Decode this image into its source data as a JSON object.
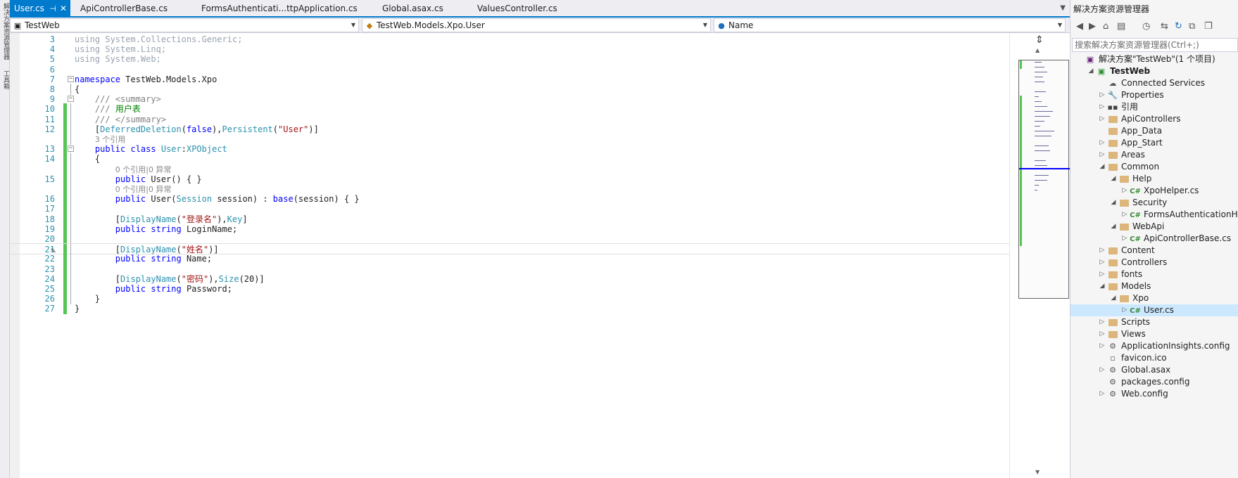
{
  "left_strip": {
    "tabs": [
      "解决方案资源管理器",
      "工具箱"
    ]
  },
  "tabs": [
    {
      "label": "User.cs",
      "active": true,
      "pin": "⊣",
      "close": "✕"
    },
    {
      "label": "ApiControllerBase.cs"
    },
    {
      "label": "FormsAuthenticati...ttpApplication.cs"
    },
    {
      "label": "Global.asax.cs"
    },
    {
      "label": "ValuesController.cs"
    }
  ],
  "nav": {
    "project": "TestWeb",
    "type": "TestWeb.Models.Xpo.User",
    "member": "Name"
  },
  "code": {
    "lines": [
      {
        "n": "3",
        "html": "<span class='dim'>using System.Collections.Generic;</span>"
      },
      {
        "n": "4",
        "html": "<span class='dim'>using System.Linq;</span>"
      },
      {
        "n": "5",
        "html": "<span class='dim'>using System.Web;</span>"
      },
      {
        "n": "6",
        "html": ""
      },
      {
        "n": "7",
        "html": "<span class='kw'>namespace</span> TestWeb.Models.Xpo"
      },
      {
        "n": "8",
        "html": "{"
      },
      {
        "n": "9",
        "html": "    <span class='gr'>/// &lt;summary&gt;</span>"
      },
      {
        "n": "10",
        "html": "    <span class='gr'>///</span> <span class='cm'>用户表</span>"
      },
      {
        "n": "11",
        "html": "    <span class='gr'>/// &lt;/summary&gt;</span>"
      },
      {
        "n": "12",
        "html": "    [<span class='tp'>DeferredDeletion</span>(<span class='kw'>false</span>),<span class='tp'>Persistent</span>(<span class='st'>\"User\"</span>)]"
      },
      {
        "n": "",
        "html": "    <span class='lens'>3 个引用</span>"
      },
      {
        "n": "13",
        "html": "    <span class='kw'>public class</span> <span class='tp'>User</span>:<span class='tp'>XPObject</span>"
      },
      {
        "n": "14",
        "html": "    {"
      },
      {
        "n": "",
        "html": "        <span class='lens'>0 个引用|0 异常</span>"
      },
      {
        "n": "15",
        "html": "        <span class='kw'>public</span> User() { }"
      },
      {
        "n": "",
        "html": "        <span class='lens'>0 个引用|0 异常</span>"
      },
      {
        "n": "16",
        "html": "        <span class='kw'>public</span> User(<span class='tp'>Session</span> session) : <span class='kw'>base</span>(session) { }"
      },
      {
        "n": "17",
        "html": ""
      },
      {
        "n": "18",
        "html": "        [<span class='tp'>DisplayName</span>(<span class='st'>\"登录名\"</span>),<span class='tp'>Key</span>]"
      },
      {
        "n": "19",
        "html": "        <span class='kw'>public string</span> LoginName;"
      },
      {
        "n": "20",
        "html": ""
      },
      {
        "n": "21",
        "html": "        [<span class='tp'>DisplayName</span>(<span class='st'>\"姓名\"</span>)]"
      },
      {
        "n": "22",
        "html": "        <span class='kw'>public string</span> Name;"
      },
      {
        "n": "23",
        "html": ""
      },
      {
        "n": "24",
        "html": "        [<span class='tp'>DisplayName</span>(<span class='st'>\"密码\"</span>),<span class='tp'>Size</span>(20)]"
      },
      {
        "n": "25",
        "html": "        <span class='kw'>public string</span> Password;"
      },
      {
        "n": "26",
        "html": "    }"
      },
      {
        "n": "27",
        "html": "}"
      }
    ]
  },
  "solution_explorer": {
    "title": "解决方案资源管理器",
    "search_placeholder": "搜索解决方案资源管理器(Ctrl+;)",
    "tree": [
      {
        "label": "解决方案\"TestWeb\"(1 个项目)",
        "level": 0,
        "icon": "solution",
        "exp": ""
      },
      {
        "label": "TestWeb",
        "level": 1,
        "icon": "project",
        "exp": "open",
        "bold": true
      },
      {
        "label": "Connected Services",
        "level": 2,
        "icon": "cloud",
        "exp": ""
      },
      {
        "label": "Properties",
        "level": 2,
        "icon": "wrench",
        "exp": "closed"
      },
      {
        "label": "引用",
        "level": 2,
        "icon": "refs",
        "exp": "closed"
      },
      {
        "label": "ApiControllers",
        "level": 2,
        "icon": "folder",
        "exp": "closed"
      },
      {
        "label": "App_Data",
        "level": 2,
        "icon": "folder",
        "exp": ""
      },
      {
        "label": "App_Start",
        "level": 2,
        "icon": "folder",
        "exp": "closed"
      },
      {
        "label": "Areas",
        "level": 2,
        "icon": "folder",
        "exp": "closed"
      },
      {
        "label": "Common",
        "level": 2,
        "icon": "folder",
        "exp": "open"
      },
      {
        "label": "Help",
        "level": 3,
        "icon": "folder",
        "exp": "open"
      },
      {
        "label": "XpoHelper.cs",
        "level": 4,
        "icon": "cs",
        "exp": "closed"
      },
      {
        "label": "Security",
        "level": 3,
        "icon": "folder",
        "exp": "open"
      },
      {
        "label": "FormsAuthenticationHt",
        "level": 4,
        "icon": "cs",
        "exp": "closed"
      },
      {
        "label": "WebApi",
        "level": 3,
        "icon": "folder",
        "exp": "open"
      },
      {
        "label": "ApiControllerBase.cs",
        "level": 4,
        "icon": "cs",
        "exp": "closed"
      },
      {
        "label": "Content",
        "level": 2,
        "icon": "folder",
        "exp": "closed"
      },
      {
        "label": "Controllers",
        "level": 2,
        "icon": "folder",
        "exp": "closed"
      },
      {
        "label": "fonts",
        "level": 2,
        "icon": "folder",
        "exp": "closed"
      },
      {
        "label": "Models",
        "level": 2,
        "icon": "folder",
        "exp": "open"
      },
      {
        "label": "Xpo",
        "level": 3,
        "icon": "folder",
        "exp": "open"
      },
      {
        "label": "User.cs",
        "level": 4,
        "icon": "cs",
        "exp": "closed",
        "selected": true
      },
      {
        "label": "Scripts",
        "level": 2,
        "icon": "folder",
        "exp": "closed"
      },
      {
        "label": "Views",
        "level": 2,
        "icon": "folder",
        "exp": "closed"
      },
      {
        "label": "ApplicationInsights.config",
        "level": 2,
        "icon": "config",
        "exp": "closed"
      },
      {
        "label": "favicon.ico",
        "level": 2,
        "icon": "file",
        "exp": ""
      },
      {
        "label": "Global.asax",
        "level": 2,
        "icon": "config",
        "exp": "closed"
      },
      {
        "label": "packages.config",
        "level": 2,
        "icon": "config",
        "exp": ""
      },
      {
        "label": "Web.config",
        "level": 2,
        "icon": "config",
        "exp": "closed"
      }
    ]
  },
  "colors": {
    "accent": "#007acc",
    "change_bar": "#57c556",
    "selection": "#cce8ff"
  }
}
